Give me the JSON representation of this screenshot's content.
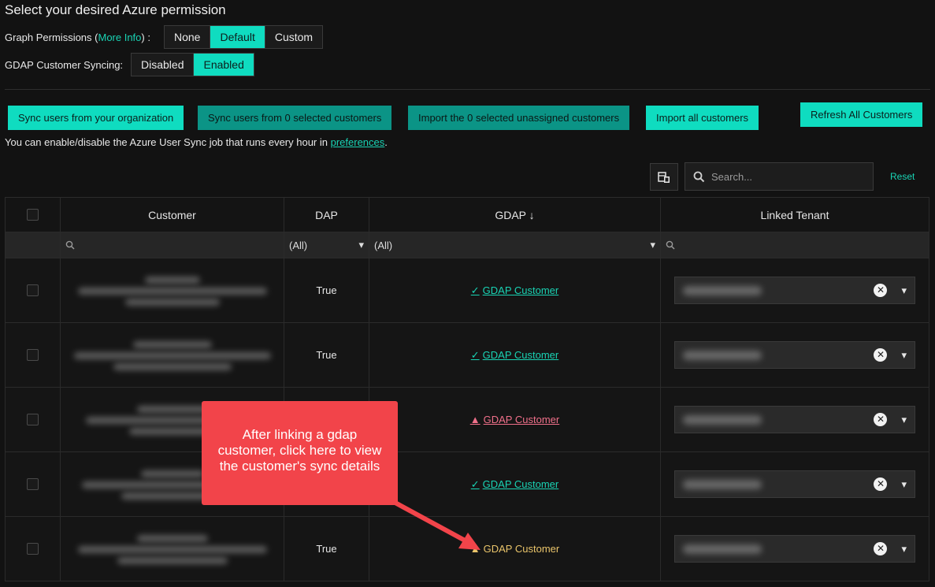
{
  "page": {
    "title": "Select your desired Azure permission"
  },
  "graph": {
    "label": "Graph Permissions (",
    "more_info": "More Info",
    "label_end": ") :",
    "options": [
      "None",
      "Default",
      "Custom"
    ],
    "selected": "Default"
  },
  "gdap_sync": {
    "label": "GDAP Customer Syncing:",
    "options": [
      "Disabled",
      "Enabled"
    ],
    "selected": "Enabled"
  },
  "actions": {
    "sync_org": "Sync users from your organization",
    "sync_selected": "Sync users from 0 selected customers",
    "import_selected": "Import the 0 selected unassigned customers",
    "import_all": "Import all customers",
    "refresh_all": "Refresh All Customers"
  },
  "note": {
    "text": "You can enable/disable the Azure User Sync job that runs every hour in ",
    "link": "preferences",
    "end": "."
  },
  "search": {
    "placeholder": "Search...",
    "reset": "Reset"
  },
  "grid": {
    "columns": [
      "Customer",
      "DAP",
      "GDAP ↓",
      "Linked Tenant"
    ],
    "filters": {
      "dap": "(All)",
      "gdap": "(All)"
    },
    "rows": [
      {
        "dap": "True",
        "gdap": "GDAP Customer",
        "gdap_status": "ok"
      },
      {
        "dap": "True",
        "gdap": "GDAP Customer",
        "gdap_status": "ok"
      },
      {
        "dap": "",
        "gdap": "GDAP Customer",
        "gdap_status": "warning"
      },
      {
        "dap": "",
        "gdap": "GDAP Customer",
        "gdap_status": "ok"
      },
      {
        "dap": "True",
        "gdap": "GDAP Customer",
        "gdap_status": "info"
      }
    ]
  },
  "callout": {
    "lines": [
      "After linking a gdap",
      "customer, click here to view",
      "the customer's sync details"
    ]
  },
  "colors": {
    "accent": "#0fdcc0",
    "warning": "#f0708a",
    "callout": "#f2444a"
  }
}
